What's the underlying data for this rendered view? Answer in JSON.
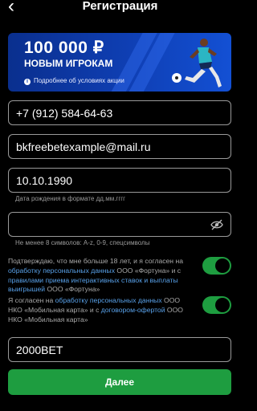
{
  "header": {
    "title": "Регистрация"
  },
  "banner": {
    "amount": "100 000 ₽",
    "subtitle": "НОВЫМ ИГРОКАМ",
    "details_link": "Подробнее об условиях акции"
  },
  "form": {
    "phone": {
      "value": "+7 (912) 584-64-63"
    },
    "email": {
      "value": "bkfreebetexample@mail.ru"
    },
    "birthdate": {
      "value": "10.10.1990",
      "hint": "Дата рождения в формате дд.мм.гггг"
    },
    "password": {
      "value": "",
      "hint": "Не менее 8 символов: A-z, 0-9, спецсимволы"
    },
    "consent1": {
      "part1": "Подтверждаю, что мне больше 18 лет, и я согласен на ",
      "link1": "обработку персональных данных",
      "part2": " ООО «Фортуна» и с ",
      "link2": "правилами приема интерактивных ставок и выплаты выигрышей",
      "part3": " ООО «Фортуна»",
      "checked": true
    },
    "consent2": {
      "part1": "Я согласен на ",
      "link1": "обработку персональных данных",
      "part2": " ООО НКО «Мобильная карта» и с ",
      "link2": "договором-офертой",
      "part3": " ООО НКО «Мобильная карта»",
      "checked": true
    },
    "promo": {
      "value": "2000BET"
    },
    "submit_label": "Далее"
  },
  "colors": {
    "accent": "#1e9d40",
    "link": "#58a0e8",
    "banner": "#0f3fb4"
  }
}
